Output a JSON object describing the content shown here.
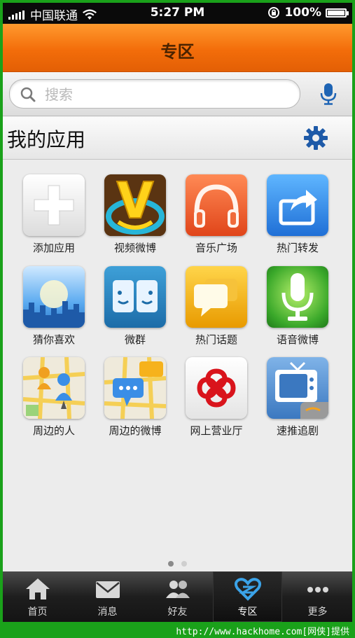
{
  "status": {
    "carrier": "中国联通",
    "time": "5:27 PM",
    "battery": "100%"
  },
  "header": {
    "title": "专区"
  },
  "search": {
    "placeholder": "搜索"
  },
  "section": {
    "title": "我的应用"
  },
  "apps": [
    {
      "label": "添加应用",
      "icon": "add-icon"
    },
    {
      "label": "视频微博",
      "icon": "video-v-icon"
    },
    {
      "label": "音乐广场",
      "icon": "headphones-icon"
    },
    {
      "label": "热门转发",
      "icon": "share-arrow-icon"
    },
    {
      "label": "猜你喜欢",
      "icon": "city-skyline-icon"
    },
    {
      "label": "微群",
      "icon": "group-faces-icon"
    },
    {
      "label": "热门话题",
      "icon": "speech-bubbles-icon"
    },
    {
      "label": "语音微博",
      "icon": "microphone-icon"
    },
    {
      "label": "周边的人",
      "icon": "map-people-icon"
    },
    {
      "label": "周边的微博",
      "icon": "map-bubble-icon"
    },
    {
      "label": "网上营业厅",
      "icon": "unicom-logo-icon"
    },
    {
      "label": "速推追剧",
      "icon": "tv-icon"
    }
  ],
  "page_indicator": {
    "pages": 2,
    "current": 1
  },
  "tabs": [
    {
      "label": "首页",
      "icon": "home-icon"
    },
    {
      "label": "消息",
      "icon": "mail-icon"
    },
    {
      "label": "好友",
      "icon": "friends-icon"
    },
    {
      "label": "专区",
      "icon": "heart-zone-icon",
      "active": true
    },
    {
      "label": "更多",
      "icon": "more-dots-icon"
    }
  ],
  "watermark": "http://www.hackhome.com[网侠]提供",
  "colors": {
    "header_orange": "#f36d0a",
    "frame_green": "#1aa11a",
    "tab_active_blue": "#3ba3e8"
  }
}
